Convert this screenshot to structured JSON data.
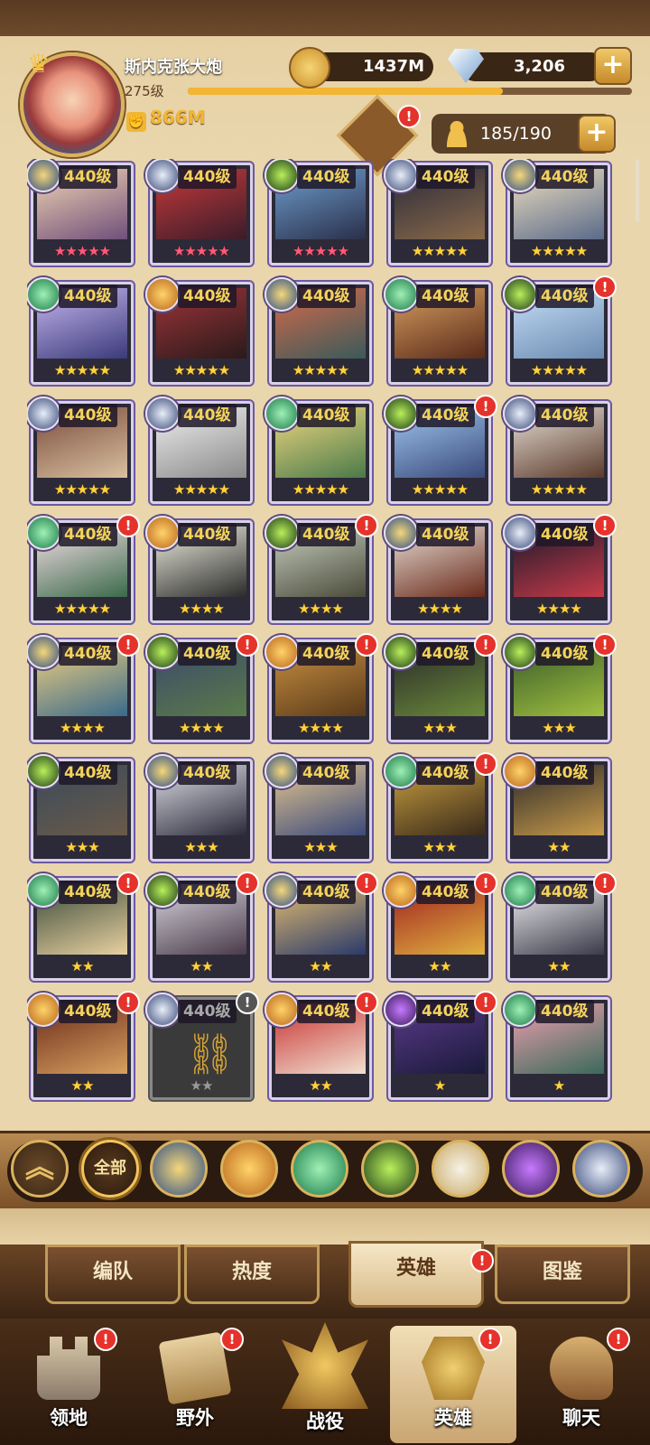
{
  "player": {
    "name": "斯内克张大炮",
    "level": "275级",
    "xp_fraction": 0.71,
    "power": "866M"
  },
  "currency": {
    "gold": "1437M",
    "gems": "3,206"
  },
  "hero_count": "185/190",
  "plus_symbol": "+",
  "badge_symbol": "!",
  "lock_symbol": "⛓",
  "collapse_symbol": "︽",
  "colors": {
    "accent_gold": "#f2b634",
    "badge_red": "#e5322b",
    "star_gold": "#ffd23c",
    "star_red": "#ff5a7a",
    "card_border": "#6c58a0"
  },
  "heroes": [
    {
      "level": "440级",
      "faction": "lightbearer",
      "stars": 5,
      "star_color": "red",
      "badge": false,
      "icon": "hero-portrait"
    },
    {
      "level": "440级",
      "faction": "dimensional",
      "stars": 5,
      "star_color": "red",
      "badge": false,
      "icon": "hero-portrait"
    },
    {
      "level": "440级",
      "faction": "graveborn",
      "stars": 5,
      "star_color": "red",
      "badge": false,
      "icon": "hero-portrait"
    },
    {
      "level": "440级",
      "faction": "dimensional",
      "stars": 5,
      "star_color": "gold",
      "badge": false,
      "icon": "hero-portrait"
    },
    {
      "level": "440级",
      "faction": "lightbearer",
      "stars": 5,
      "star_color": "gold",
      "badge": false,
      "icon": "hero-portrait"
    },
    {
      "level": "440级",
      "faction": "wilder",
      "stars": 5,
      "star_color": "gold",
      "badge": false,
      "icon": "hero-portrait"
    },
    {
      "level": "440级",
      "faction": "mauler",
      "stars": 5,
      "star_color": "gold",
      "badge": false,
      "icon": "hero-portrait"
    },
    {
      "level": "440级",
      "faction": "lightbearer",
      "stars": 5,
      "star_color": "gold",
      "badge": false,
      "icon": "hero-portrait"
    },
    {
      "level": "440级",
      "faction": "wilder",
      "stars": 5,
      "star_color": "gold",
      "badge": false,
      "icon": "hero-portrait"
    },
    {
      "level": "440级",
      "faction": "graveborn",
      "stars": 5,
      "star_color": "gold",
      "badge": true,
      "icon": "hero-portrait"
    },
    {
      "level": "440级",
      "faction": "dimensional",
      "stars": 5,
      "star_color": "gold",
      "badge": false,
      "icon": "hero-portrait"
    },
    {
      "level": "440级",
      "faction": "dimensional",
      "stars": 5,
      "star_color": "gold",
      "badge": false,
      "icon": "hero-portrait"
    },
    {
      "level": "440级",
      "faction": "wilder",
      "stars": 5,
      "star_color": "gold",
      "badge": false,
      "icon": "hero-portrait"
    },
    {
      "level": "440级",
      "faction": "graveborn",
      "stars": 5,
      "star_color": "gold",
      "badge": true,
      "icon": "hero-portrait"
    },
    {
      "level": "440级",
      "faction": "dimensional",
      "stars": 5,
      "star_color": "gold",
      "badge": false,
      "icon": "hero-portrait"
    },
    {
      "level": "440级",
      "faction": "wilder",
      "stars": 5,
      "star_color": "gold",
      "badge": true,
      "icon": "hero-portrait"
    },
    {
      "level": "440级",
      "faction": "mauler",
      "stars": 4,
      "star_color": "gold",
      "badge": false,
      "icon": "hero-portrait"
    },
    {
      "level": "440级",
      "faction": "graveborn",
      "stars": 4,
      "star_color": "gold",
      "badge": true,
      "icon": "hero-portrait"
    },
    {
      "level": "440级",
      "faction": "lightbearer",
      "stars": 4,
      "star_color": "gold",
      "badge": false,
      "icon": "hero-portrait"
    },
    {
      "level": "440级",
      "faction": "dimensional",
      "stars": 4,
      "star_color": "gold",
      "badge": true,
      "icon": "hero-portrait"
    },
    {
      "level": "440级",
      "faction": "lightbearer",
      "stars": 4,
      "star_color": "gold",
      "badge": true,
      "icon": "hero-portrait"
    },
    {
      "level": "440级",
      "faction": "graveborn",
      "stars": 4,
      "star_color": "gold",
      "badge": true,
      "icon": "hero-portrait"
    },
    {
      "level": "440级",
      "faction": "mauler",
      "stars": 4,
      "star_color": "gold",
      "badge": true,
      "icon": "hero-portrait"
    },
    {
      "level": "440级",
      "faction": "graveborn",
      "stars": 3,
      "star_color": "gold",
      "badge": true,
      "icon": "hero-portrait"
    },
    {
      "level": "440级",
      "faction": "graveborn",
      "stars": 3,
      "star_color": "gold",
      "badge": true,
      "icon": "hero-portrait"
    },
    {
      "level": "440级",
      "faction": "graveborn",
      "stars": 3,
      "star_color": "gold",
      "badge": false,
      "icon": "hero-portrait"
    },
    {
      "level": "440级",
      "faction": "lightbearer",
      "stars": 3,
      "star_color": "gold",
      "badge": false,
      "icon": "hero-portrait"
    },
    {
      "level": "440级",
      "faction": "lightbearer",
      "stars": 3,
      "star_color": "gold",
      "badge": false,
      "icon": "hero-portrait"
    },
    {
      "level": "440级",
      "faction": "wilder",
      "stars": 3,
      "star_color": "gold",
      "badge": true,
      "icon": "hero-portrait"
    },
    {
      "level": "440级",
      "faction": "mauler",
      "stars": 2,
      "star_color": "gold",
      "badge": false,
      "icon": "hero-portrait"
    },
    {
      "level": "440级",
      "faction": "wilder",
      "stars": 2,
      "star_color": "gold",
      "badge": true,
      "icon": "hero-portrait"
    },
    {
      "level": "440级",
      "faction": "graveborn",
      "stars": 2,
      "star_color": "gold",
      "badge": true,
      "icon": "hero-portrait"
    },
    {
      "level": "440级",
      "faction": "lightbearer",
      "stars": 2,
      "star_color": "gold",
      "badge": true,
      "icon": "hero-portrait"
    },
    {
      "level": "440级",
      "faction": "mauler",
      "stars": 2,
      "star_color": "gold",
      "badge": true,
      "icon": "hero-portrait"
    },
    {
      "level": "440级",
      "faction": "wilder",
      "stars": 2,
      "star_color": "gold",
      "badge": true,
      "icon": "hero-portrait"
    },
    {
      "level": "440级",
      "faction": "mauler",
      "stars": 2,
      "star_color": "gold",
      "badge": true,
      "icon": "hero-portrait"
    },
    {
      "level": "440级",
      "faction": "dimensional",
      "stars": 2,
      "star_color": "grey",
      "badge": true,
      "locked": true,
      "icon": "chain-lock-icon"
    },
    {
      "level": "440级",
      "faction": "mauler",
      "stars": 2,
      "star_color": "gold",
      "badge": true,
      "icon": "hero-portrait"
    },
    {
      "level": "440级",
      "faction": "hypogean",
      "stars": 1,
      "star_color": "gold",
      "badge": true,
      "icon": "hero-portrait"
    },
    {
      "level": "440级",
      "faction": "wilder",
      "stars": 1,
      "star_color": "gold",
      "badge": false,
      "icon": "hero-portrait"
    }
  ],
  "filter": {
    "all_label": "全部",
    "factions": [
      "lightbearer",
      "mauler",
      "wilder",
      "graveborn",
      "celestial",
      "hypogean",
      "dimensional"
    ],
    "selected": "all"
  },
  "tabs": [
    {
      "label": "编队",
      "active": false,
      "badge": false
    },
    {
      "label": "热度",
      "active": false,
      "badge": false
    },
    {
      "label": "英雄",
      "active": true,
      "badge": true
    },
    {
      "label": "图鉴",
      "active": false,
      "badge": false
    }
  ],
  "nav": [
    {
      "id": "territory",
      "label": "领地",
      "badge": true,
      "active": false,
      "icon": "castle-icon"
    },
    {
      "id": "wild",
      "label": "野外",
      "badge": true,
      "active": false,
      "icon": "scroll-map-icon"
    },
    {
      "id": "campaign",
      "label": "战役",
      "badge": false,
      "active": false,
      "icon": "sword-crest-icon"
    },
    {
      "id": "heroes",
      "label": "英雄",
      "badge": true,
      "active": true,
      "icon": "helmet-icon"
    },
    {
      "id": "chat",
      "label": "聊天",
      "badge": true,
      "active": false,
      "icon": "chat-bubble-icon"
    }
  ]
}
